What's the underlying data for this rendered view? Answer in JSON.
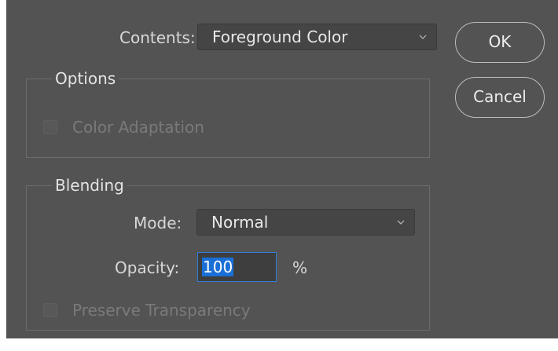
{
  "contents": {
    "label": "Contents:",
    "value": "Foreground Color"
  },
  "buttons": {
    "ok": "OK",
    "cancel": "Cancel"
  },
  "options": {
    "legend": "Options",
    "color_adaptation": {
      "label": "Color Adaptation",
      "checked": false,
      "enabled": false
    }
  },
  "blending": {
    "legend": "Blending",
    "mode_label": "Mode:",
    "mode_value": "Normal",
    "opacity_label": "Opacity:",
    "opacity_value": "100",
    "opacity_unit": "%",
    "preserve_transparency": {
      "label": "Preserve Transparency",
      "checked": false,
      "enabled": false
    }
  },
  "icons": {
    "dropdown": "chevron-down-icon"
  },
  "colors": {
    "dialog_bg": "#535353",
    "focus_border": "#2f7ed8",
    "selection": "#1a6fd6"
  }
}
